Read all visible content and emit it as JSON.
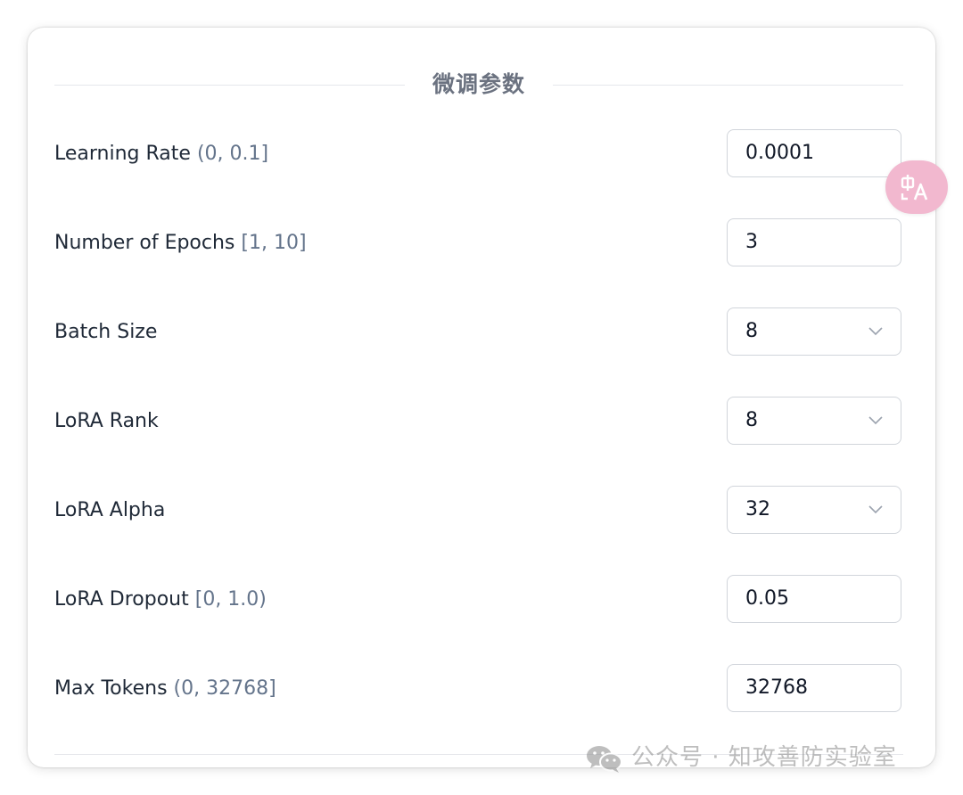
{
  "section": {
    "title": "微调参数"
  },
  "params": [
    {
      "label": "Learning Rate",
      "range": "(0, 0.1]",
      "value": "0.0001",
      "control": "input"
    },
    {
      "label": "Number of Epochs",
      "range": "[1, 10]",
      "value": "3",
      "control": "input"
    },
    {
      "label": "Batch Size",
      "range": "",
      "value": "8",
      "control": "select"
    },
    {
      "label": "LoRA Rank",
      "range": "",
      "value": "8",
      "control": "select"
    },
    {
      "label": "LoRA Alpha",
      "range": "",
      "value": "32",
      "control": "select"
    },
    {
      "label": "LoRA Dropout",
      "range": "[0, 1.0)",
      "value": "0.05",
      "control": "input"
    },
    {
      "label": "Max Tokens",
      "range": "(0, 32768]",
      "value": "32768",
      "control": "input"
    }
  ],
  "overlay": {
    "translate_icon": "translate-icon",
    "translate_color": "#f2b8cf"
  },
  "watermark": {
    "icon": "wechat-icon",
    "text": "公众号 · 知攻善防实验室"
  }
}
